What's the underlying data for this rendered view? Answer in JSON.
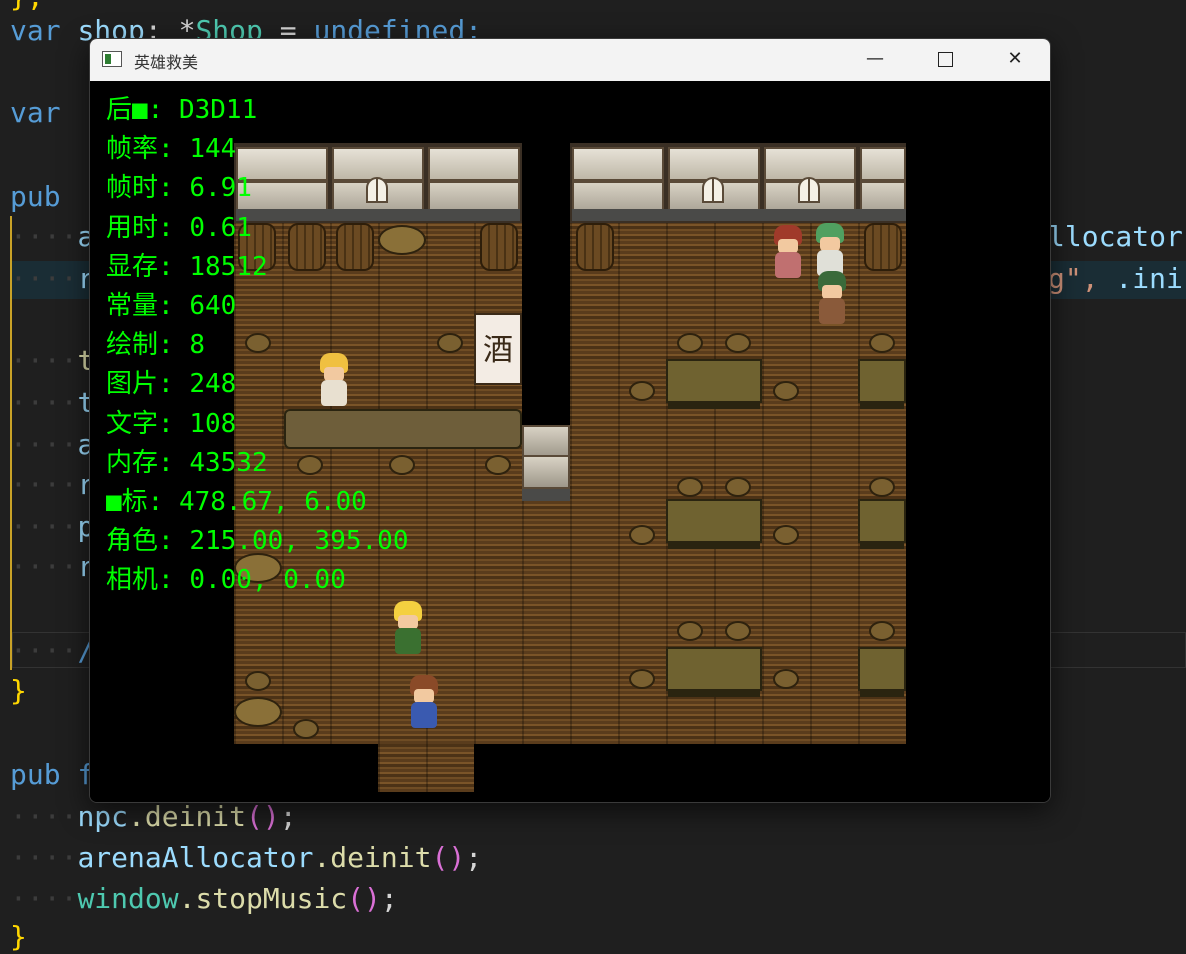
{
  "editor": {
    "lines": {
      "l1_kw": "var",
      "l1_name": "shop",
      "l1_colon": ": *",
      "l1_type": "Shop",
      "l1_eq": " = ",
      "l1_val": "undefined;",
      "l2_kw": "var",
      "l3_kw": "pub",
      "l3_rest": "f",
      "l4_rest": "a",
      "l5_rest": "r",
      "l6_rest": "t",
      "l7_rest": "t",
      "l8_rest": "a",
      "l9_rest": "r",
      "l10_rest": "p",
      "l11_rest": "r",
      "l13_rest": "/",
      "close_brace": "}",
      "pub_kw": "pub",
      "pub_rest": "f",
      "npc_obj": "npc",
      "npc_call": ".deinit",
      "arena_obj": "arenaAllocator",
      "arena_call": ".deinit",
      "window_obj": "window",
      "window_call": ".stopMusic",
      "parens": "()",
      "semicolon": ";",
      "right_frag_1": "llocator",
      "right_frag_2_str": "g\",",
      "right_frag_2_rest": " .ini"
    }
  },
  "window": {
    "title": "英雄救美",
    "minimize": "—",
    "close": "✕"
  },
  "sign_text": "酒",
  "debug": [
    {
      "label": "后■",
      "value": "D3D11"
    },
    {
      "label": "帧率",
      "value": "144"
    },
    {
      "label": "帧时",
      "value": "6.91"
    },
    {
      "label": "用时",
      "value": "0.61"
    },
    {
      "label": "显存",
      "value": "18512"
    },
    {
      "label": "常量",
      "value": "640"
    },
    {
      "label": "绘制",
      "value": "8"
    },
    {
      "label": "图片",
      "value": "248"
    },
    {
      "label": "文字",
      "value": "108"
    },
    {
      "label": "内存",
      "value": "43532"
    },
    {
      "label": "■标",
      "value": "478.67, 6.00"
    },
    {
      "label": "角色",
      "value": "215.00, 395.00"
    },
    {
      "label": "相机",
      "value": "0.00, 0.00"
    }
  ],
  "colors": {
    "debug_text": "#00ff00",
    "editor_bg": "#1f1f1f",
    "keyword": "#569cd6",
    "variable": "#9cdcfe",
    "function": "#dcdcaa",
    "paren": "#da70d6"
  }
}
